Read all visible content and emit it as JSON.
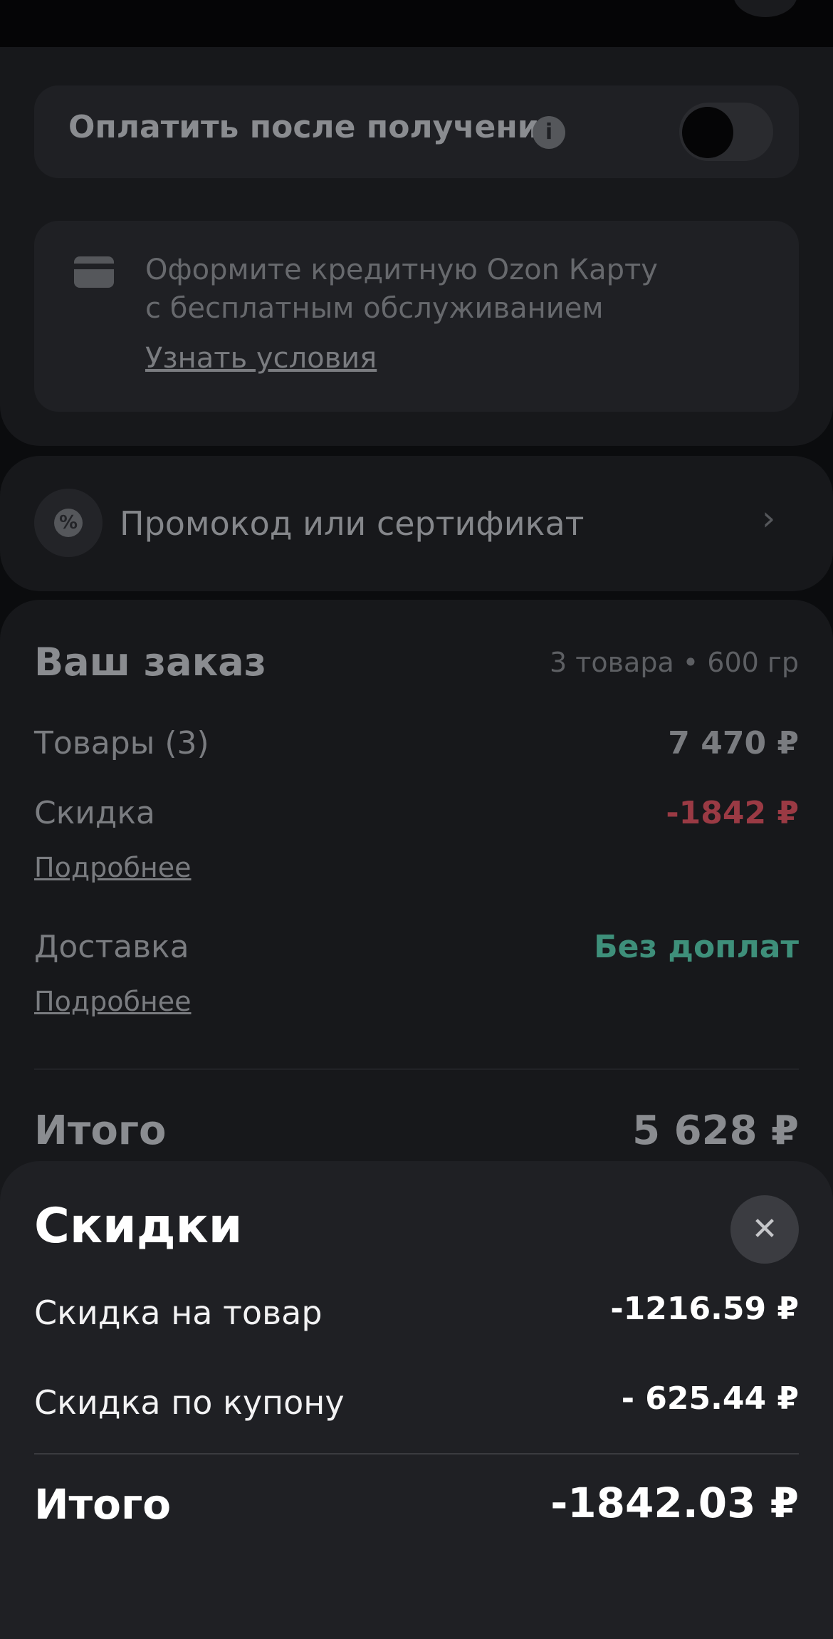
{
  "payment": {
    "pay_after_label": "Оплатить после получения",
    "info_glyph": "i",
    "pay_after_enabled": false
  },
  "credit_card_promo": {
    "line1": "Оформите кредитную Ozon Карту",
    "line2": "с бесплатным обслуживанием",
    "link": "Узнать условия"
  },
  "promo": {
    "label": "Промокод или сертификат",
    "icon_glyph": "%",
    "chevron": "›"
  },
  "order": {
    "title": "Ваш заказ",
    "meta": "3 товара • 600 гр",
    "items_label": "Товары (3)",
    "items_value": "7 470 ₽",
    "discount_label": "Скидка",
    "discount_value": "-1842 ₽",
    "discount_link": "Подробнее",
    "delivery_label": "Доставка",
    "delivery_value": "Без доплат",
    "delivery_link": "Подробнее",
    "total_label": "Итого",
    "total_value": "5 628 ₽"
  },
  "discounts_sheet": {
    "title": "Скидки",
    "close_glyph": "✕",
    "rows": [
      {
        "label": "Скидка на товар",
        "value": "-1216.59 ₽"
      },
      {
        "label": "Скидка по купону",
        "value": "- 625.44 ₽"
      }
    ],
    "total_label": "Итого",
    "total_value": "-1842.03 ₽"
  },
  "colors": {
    "discount_red": "#9a3a44",
    "delivery_green": "#3e8f7a",
    "sheet_bg": "#1f2024"
  }
}
